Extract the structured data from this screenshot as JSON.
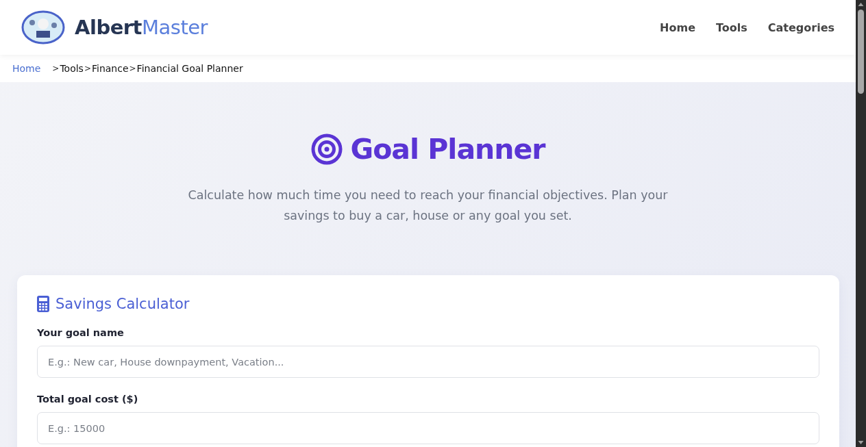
{
  "header": {
    "brand": {
      "first": "Albert",
      "second": "Master"
    },
    "nav": [
      {
        "label": "Home"
      },
      {
        "label": "Tools"
      },
      {
        "label": "Categories"
      }
    ]
  },
  "breadcrumb": {
    "separator": ">",
    "items": [
      {
        "label": "Home",
        "link": true
      },
      {
        "label": "Tools",
        "link": false
      },
      {
        "label": "Finance",
        "link": false
      },
      {
        "label": "Financial Goal Planner",
        "link": false
      }
    ]
  },
  "hero": {
    "title": "Goal Planner",
    "subtitle": "Calculate how much time you need to reach your financial objectives. Plan your savings to buy a car, house or any goal you set."
  },
  "card": {
    "title": "Savings Calculator",
    "fields": [
      {
        "label": "Your goal name",
        "placeholder": "E.g.: New car, House downpayment, Vacation..."
      },
      {
        "label": "Total goal cost ($)",
        "placeholder": "E.g.: 15000"
      }
    ]
  }
}
